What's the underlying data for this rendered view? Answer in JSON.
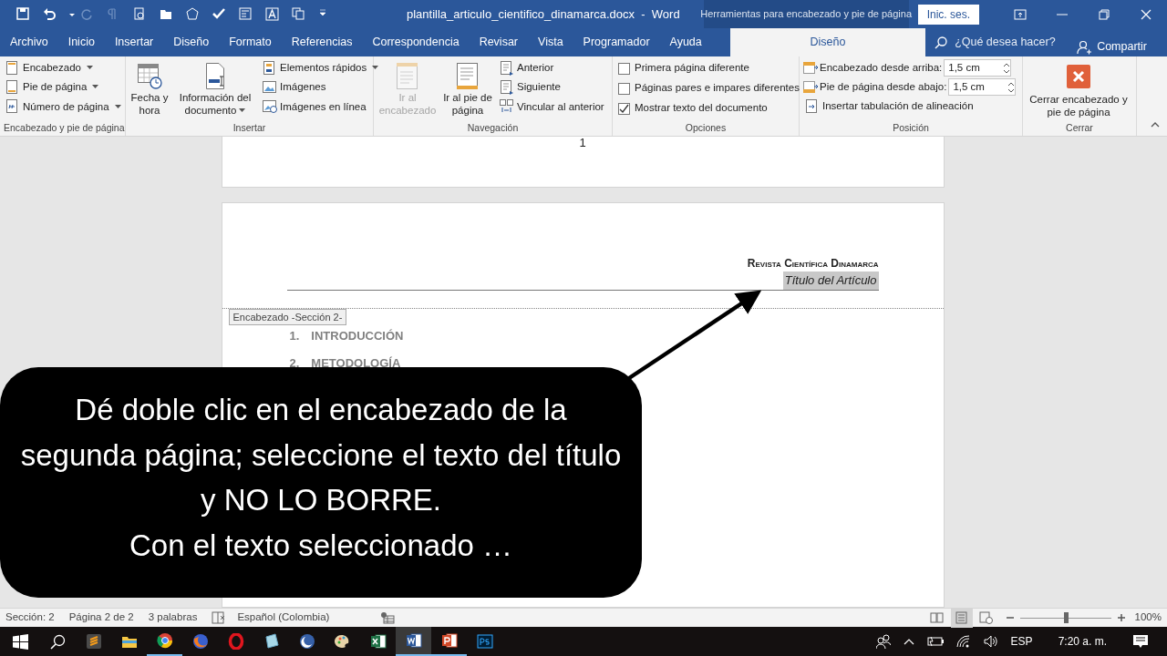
{
  "title_bar": {
    "title": "plantilla_articulo_cientifico_dinamarca.docx  -  Word",
    "context_label": "Herramientas para encabezado y pie de página",
    "signin": "Inic. ses."
  },
  "tabs": [
    {
      "label": "Archivo",
      "selected": false
    },
    {
      "label": "Inicio",
      "selected": false
    },
    {
      "label": "Insertar",
      "selected": false
    },
    {
      "label": "Diseño",
      "selected": false
    },
    {
      "label": "Formato",
      "selected": false
    },
    {
      "label": "Referencias",
      "selected": false
    },
    {
      "label": "Correspondencia",
      "selected": false
    },
    {
      "label": "Revisar",
      "selected": false
    },
    {
      "label": "Vista",
      "selected": false
    },
    {
      "label": "Programador",
      "selected": false
    },
    {
      "label": "Ayuda",
      "selected": false
    },
    {
      "label": "Diseño",
      "selected": true
    }
  ],
  "tell_me": {
    "placeholder": "¿Qué desea hacer?"
  },
  "share": "Compartir",
  "ribbon_groups": [
    {
      "label": "Encabezado y pie de página",
      "controls": [
        {
          "kind": "small",
          "label": "Encabezado",
          "dropdown": true
        },
        {
          "kind": "small",
          "label": "Pie de página",
          "dropdown": true
        },
        {
          "kind": "small",
          "label": "Número de página",
          "dropdown": true
        }
      ]
    },
    {
      "label": "Insertar",
      "controls": [
        {
          "kind": "large",
          "label": "Fecha y hora",
          "dropdown": false
        },
        {
          "kind": "large",
          "label": "Información del documento",
          "dropdown": true
        },
        {
          "kind": "small",
          "label": "Elementos rápidos",
          "dropdown": true
        },
        {
          "kind": "small",
          "label": "Imágenes",
          "dropdown": false
        },
        {
          "kind": "small",
          "label": "Imágenes en línea",
          "dropdown": false
        }
      ]
    },
    {
      "label": "Navegación",
      "controls": [
        {
          "kind": "large",
          "label": "Ir al encabezado",
          "disabled": true
        },
        {
          "kind": "large",
          "label": "Ir al pie de página",
          "disabled": false
        },
        {
          "kind": "small",
          "label": "Anterior"
        },
        {
          "kind": "small",
          "label": "Siguiente"
        },
        {
          "kind": "small",
          "label": "Vincular al anterior"
        }
      ]
    },
    {
      "label": "Opciones",
      "controls": [
        {
          "kind": "checkbox",
          "label": "Primera página diferente",
          "checked": false
        },
        {
          "kind": "checkbox",
          "label": "Páginas pares e impares diferentes",
          "checked": false
        },
        {
          "kind": "checkbox",
          "label": "Mostrar texto del documento",
          "checked": true
        }
      ]
    },
    {
      "label": "Posición",
      "controls": [
        {
          "kind": "spin",
          "label": "Encabezado desde arriba:",
          "value": "1,5 cm"
        },
        {
          "kind": "spin",
          "label": "Pie de página desde abajo:",
          "value": "1,5 cm"
        },
        {
          "kind": "small",
          "label": "Insertar tabulación de alineación"
        }
      ]
    },
    {
      "label": "Cerrar",
      "controls": [
        {
          "kind": "large",
          "label": "Cerrar encabezado y pie de página",
          "disabled": false
        }
      ]
    }
  ],
  "document": {
    "page_number": "1",
    "header_lines": [
      {
        "kind": "journal",
        "text": "Revista Científica Dinamarca",
        "selected": false
      },
      {
        "kind": "title",
        "text": "Título del Artículo",
        "selected": true
      }
    ],
    "header_tag": "Encabezado -Sección 2-",
    "headings": [
      {
        "number": "1.",
        "text": "INTRODUCCIÓN"
      },
      {
        "number": "2.",
        "text": "METODOLOGÍA"
      }
    ]
  },
  "callout": {
    "paragraphs": [
      "Dé doble clic en el encabezado de la segunda página; seleccione el texto del título y NO LO BORRE.",
      "Con el texto seleccionado …"
    ]
  },
  "status_bar": {
    "items": [
      "Sección: 2",
      "Página 2 de 2",
      "3 palabras",
      "Español (Colombia)"
    ],
    "views": [
      {
        "selected": false
      },
      {
        "selected": true
      },
      {
        "selected": false
      }
    ],
    "zoom": {
      "level": 0.5,
      "reading": "100%"
    }
  },
  "taskbar": {
    "apps": [
      {
        "running": false,
        "active": false
      },
      {
        "running": false,
        "active": false
      },
      {
        "running": true,
        "active": false
      },
      {
        "running": false,
        "active": false
      },
      {
        "running": false,
        "active": false
      },
      {
        "running": false,
        "active": false
      },
      {
        "running": false,
        "active": false
      },
      {
        "running": false,
        "active": false
      },
      {
        "running": false,
        "active": false
      },
      {
        "running": true,
        "active": true
      },
      {
        "running": true,
        "active": false
      },
      {
        "running": false,
        "active": false
      }
    ],
    "language": "ESP",
    "time": "7:20 a. m."
  }
}
